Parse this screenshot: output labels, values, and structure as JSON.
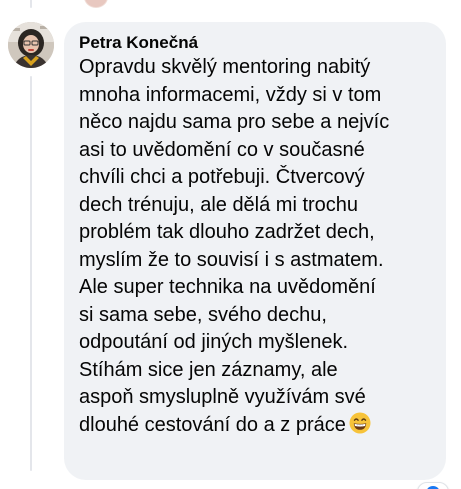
{
  "comment": {
    "author": "Petra Konečná",
    "text_lines": [
      "Opravdu skvělý mentoring nabitý",
      "mnoha informacemi, vždy si v tom",
      "něco najdu sama pro sebe a nejvíc",
      "asi to uvědomění co v současné",
      "chvíli chci a potřebuji. Čtvercový",
      "dech trénuju, ale dělá mi trochu",
      "problém tak dlouho zadržet dech,",
      "myslím že to souvisí i s astmatem.",
      "Ale super technika na uvědomění",
      "si sama sebe, svého dechu,",
      "odpoutání od jiných myšlenek.",
      "Stíhám sice jen záznamy, ale",
      "aspoň smysluplně využívám své",
      "dlouhé cestování do a z práce"
    ],
    "emoji_icon": "grinning-face-with-smiling-eyes-icon"
  },
  "colors": {
    "bubble_background": "#f0f2f5",
    "text": "#050505",
    "thread_line": "#e4e6eb"
  }
}
